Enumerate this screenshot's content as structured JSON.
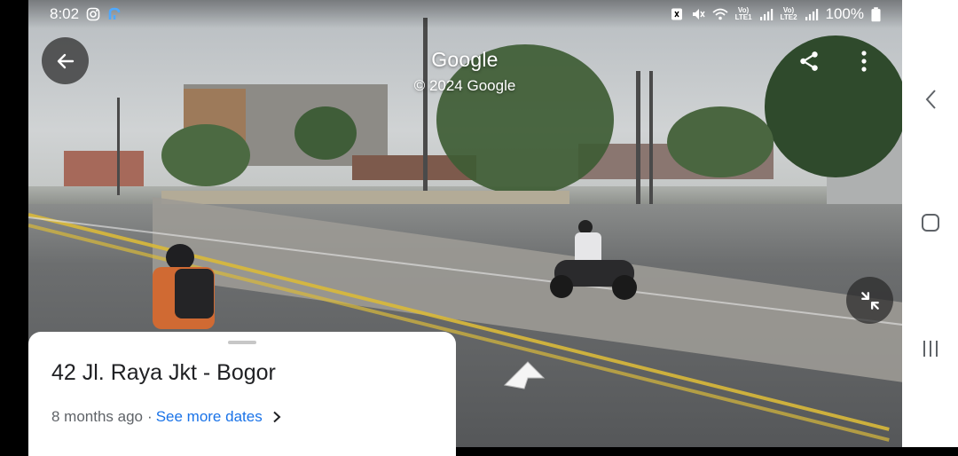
{
  "status_bar": {
    "time": "8:02",
    "left_icons": [
      "instagram-icon",
      "app-r-icon"
    ],
    "right_icons": [
      "nfc-icon",
      "mute-icon",
      "wifi-icon",
      "signal-lte1-icon",
      "signal-lte2-icon"
    ],
    "net1_label": "Vo)\nLTE1",
    "net2_label": "Vo)\nLTE2",
    "battery": "100%"
  },
  "viewer": {
    "brand": "Google",
    "copyright": "© 2024 Google",
    "back_icon": "back-arrow-icon",
    "share_icon": "share-icon",
    "menu_icon": "more-vert-icon",
    "exit_fullscreen_icon": "collapse-icon",
    "navigate_arrow_icon": "street-arrow-icon"
  },
  "location_card": {
    "address": "42 Jl. Raya Jkt - Bogor",
    "age": "8 months ago",
    "separator": "·",
    "see_more": "See more dates"
  },
  "nav_bar": {
    "items": [
      "back-nav-icon",
      "home-nav-icon",
      "recents-nav-icon"
    ]
  },
  "colors": {
    "link": "#1a73e8",
    "overlay_button": "#282828"
  }
}
